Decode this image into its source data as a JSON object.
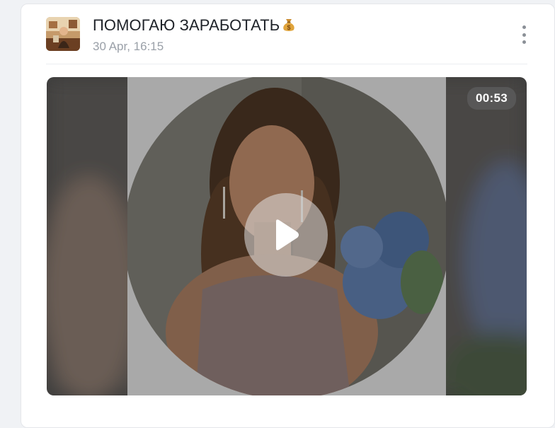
{
  "post": {
    "channel_name": "ПОМОГАЮ ЗАРАБОТАТЬ",
    "channel_emoji_icon": "money-bag-icon",
    "date": "30 Apr, 16:15",
    "more_icon": "more-vertical-icon"
  },
  "video": {
    "duration": "00:53",
    "play_icon": "play-icon",
    "type": "round video message"
  }
}
